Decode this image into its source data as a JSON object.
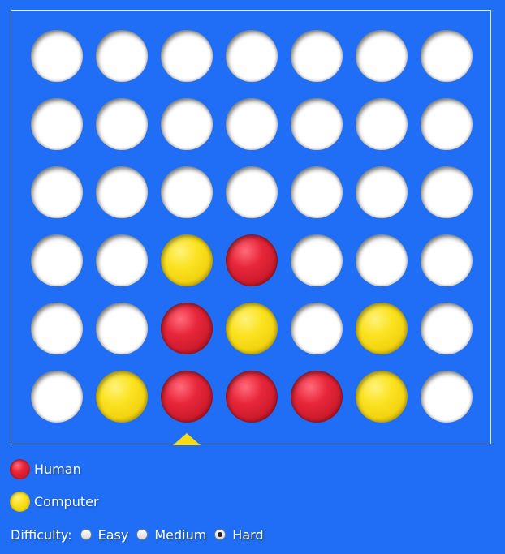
{
  "board": {
    "rows": 6,
    "columns": 7,
    "grid": [
      [
        "empty",
        "empty",
        "empty",
        "empty",
        "empty",
        "empty",
        "empty"
      ],
      [
        "empty",
        "empty",
        "empty",
        "empty",
        "empty",
        "empty",
        "empty"
      ],
      [
        "empty",
        "empty",
        "empty",
        "empty",
        "empty",
        "empty",
        "empty"
      ],
      [
        "empty",
        "empty",
        "yellow",
        "red",
        "empty",
        "empty",
        "empty"
      ],
      [
        "empty",
        "empty",
        "red",
        "yellow",
        "empty",
        "yellow",
        "empty"
      ],
      [
        "empty",
        "yellow",
        "red",
        "red",
        "red",
        "yellow",
        "empty"
      ]
    ],
    "drop_marker_column": 2,
    "colors": {
      "board": "#1f6ef5",
      "red": "#e8263a",
      "yellow": "#fbe321",
      "marker": "#f6dc18"
    }
  },
  "legend": {
    "human_label": "Human",
    "computer_label": "Computer"
  },
  "difficulty": {
    "label": "Difficulty:",
    "options": [
      "Easy",
      "Medium",
      "Hard"
    ],
    "selected": "Hard"
  }
}
